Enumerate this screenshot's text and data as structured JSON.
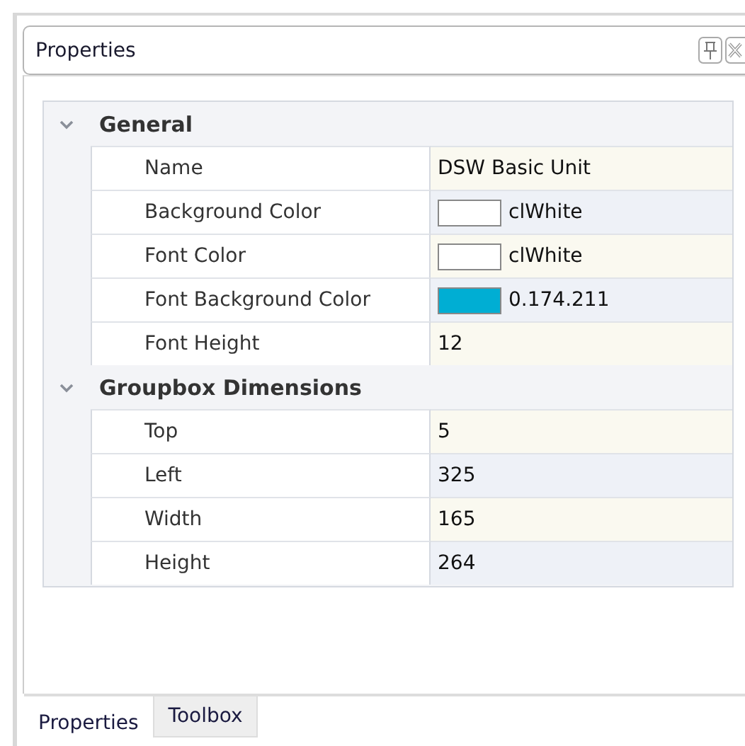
{
  "panel": {
    "title": "Properties"
  },
  "categories": [
    {
      "name": "General",
      "expanded": true,
      "properties": [
        {
          "name": "Name",
          "kind": "text",
          "value": "DSW Basic Unit"
        },
        {
          "name": "Background Color",
          "kind": "color",
          "color": "#ffffff",
          "value": "clWhite"
        },
        {
          "name": "Font Color",
          "kind": "color",
          "color": "#ffffff",
          "value": "clWhite"
        },
        {
          "name": "Font Background Color",
          "kind": "color",
          "color": "#00aed3",
          "value": "0.174.211"
        },
        {
          "name": "Font Height",
          "kind": "text",
          "value": "12"
        }
      ]
    },
    {
      "name": "Groupbox Dimensions",
      "expanded": true,
      "properties": [
        {
          "name": "Top",
          "kind": "text",
          "value": "5"
        },
        {
          "name": "Left",
          "kind": "text",
          "value": "325"
        },
        {
          "name": "Width",
          "kind": "text",
          "value": "165"
        },
        {
          "name": "Height",
          "kind": "text",
          "value": "264"
        }
      ]
    }
  ],
  "tabs": [
    {
      "label": "Properties",
      "selected": true
    },
    {
      "label": "Toolbox",
      "selected": false
    }
  ]
}
